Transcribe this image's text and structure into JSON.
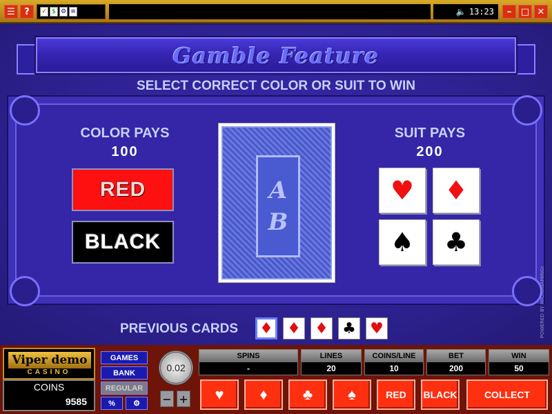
{
  "topbar": {
    "menu_icon": "menu-icon",
    "help_label": "?",
    "clock": "13:23",
    "sound_icon": "speaker-icon",
    "window_buttons": [
      "minimize-icon",
      "maximize-icon",
      "close-icon"
    ]
  },
  "game": {
    "title": "Gamble Feature",
    "instruction": "SELECT CORRECT COLOR OR SUIT TO WIN",
    "color_pays_label": "COLOR PAYS",
    "color_pays_value": "100",
    "suit_pays_label": "SUIT PAYS",
    "suit_pays_value": "200",
    "red_label": "RED",
    "black_label": "BLACK",
    "card_monogram": [
      "A",
      "B"
    ],
    "suits": {
      "hearts": "♥",
      "diamonds": "♦",
      "spades": "♠",
      "clubs": "♣"
    },
    "previous_cards_label": "PREVIOUS CARDS",
    "previous_cards": [
      "♦",
      "♦",
      "♦",
      "♣",
      "♥"
    ],
    "powered_by": "POWERED BY MICROGAMING™"
  },
  "panel": {
    "brand_logo": "Viper demo",
    "brand_sub": "CASINO",
    "coins_label": "COINS",
    "coins_value": "9585",
    "menu": [
      "GAMES",
      "BANK",
      "REGULAR",
      "%"
    ],
    "coin_size": "0.02",
    "stats": [
      {
        "label": "SPINS",
        "value": "-"
      },
      {
        "label": "LINES",
        "value": "20"
      },
      {
        "label": "COINS/LINE",
        "value": "10"
      },
      {
        "label": "BET",
        "value": "200"
      },
      {
        "label": "WIN",
        "value": "50"
      }
    ],
    "red_label": "RED",
    "black_label": "BLACK",
    "collect_label": "COLLECT"
  },
  "colors": {
    "red": "#ff1010",
    "felt": "#3426a6",
    "gold": "#d8a828"
  }
}
